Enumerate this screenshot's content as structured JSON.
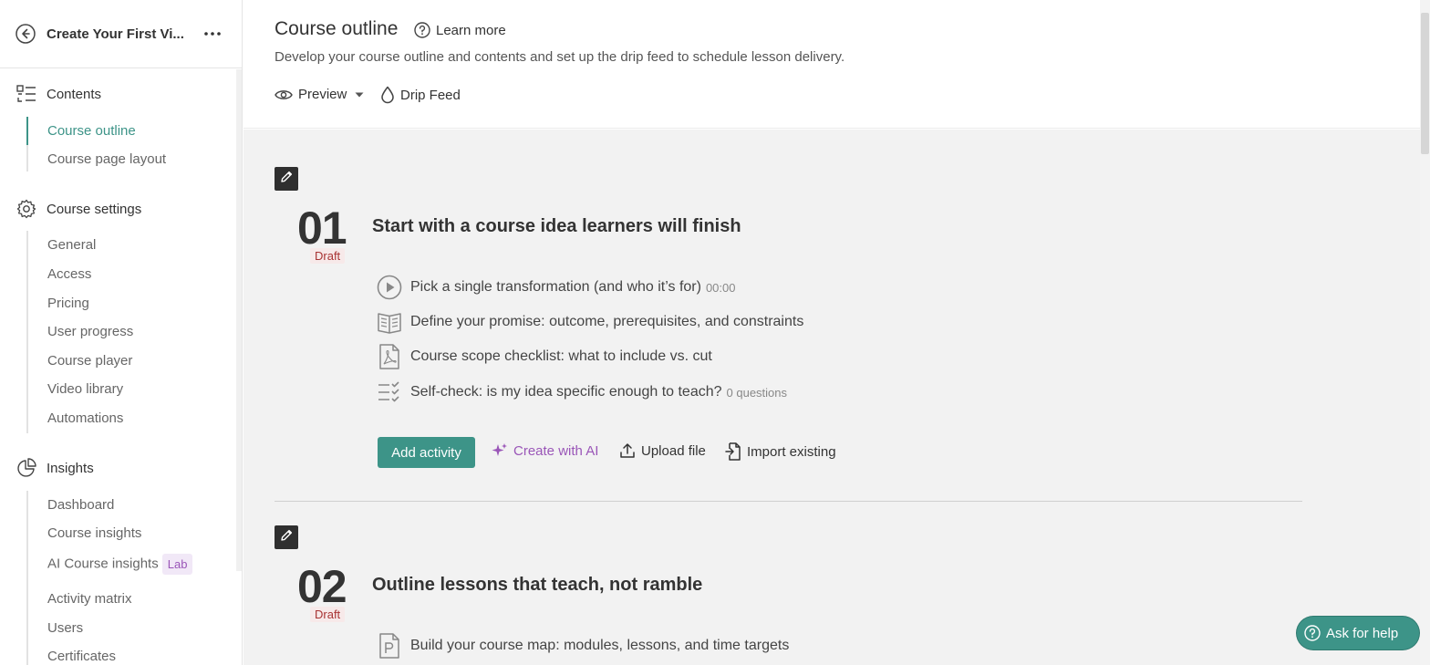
{
  "sidebar": {
    "course_title": "Create Your First Vi...",
    "sections": {
      "contents": "Contents",
      "settings": "Course settings",
      "insights": "Insights"
    },
    "contents_items": [
      "Course outline",
      "Course page layout"
    ],
    "settings_items": [
      "General",
      "Access",
      "Pricing",
      "User progress",
      "Course player",
      "Video library",
      "Automations"
    ],
    "insights_items": [
      "Dashboard",
      "Course insights",
      "AI Course insights",
      "Activity matrix",
      "Users",
      "Certificates"
    ],
    "lab_badge": "Lab"
  },
  "header": {
    "title": "Course outline",
    "learn_more": "Learn more",
    "subtitle": "Develop your course outline and contents and set up the drip feed to schedule lesson delivery.",
    "preview": "Preview",
    "drip_feed": "Drip Feed"
  },
  "chapters": [
    {
      "number": "01",
      "status": "Draft",
      "title": "Start with a course idea learners will finish",
      "activities": [
        {
          "icon": "video-play-icon",
          "label": "Pick a single transformation (and who it’s for)",
          "meta": "00:00"
        },
        {
          "icon": "open-book-icon",
          "label": "Define your promise: outcome, prerequisites, and constraints",
          "meta": ""
        },
        {
          "icon": "pdf-file-icon",
          "label": "Course scope checklist: what to include vs. cut",
          "meta": ""
        },
        {
          "icon": "quiz-checklist-icon",
          "label": "Self-check: is my idea specific enough to teach?",
          "meta": "0 questions"
        }
      ]
    },
    {
      "number": "02",
      "status": "Draft",
      "title": "Outline lessons that teach, not ramble",
      "activities": [
        {
          "icon": "presentation-file-icon",
          "label": "Build your course map: modules, lessons, and time targets",
          "meta": ""
        }
      ]
    }
  ],
  "actions": {
    "add_activity": "Add activity",
    "create_ai": "Create with AI",
    "upload_file": "Upload file",
    "import_existing": "Import existing"
  },
  "help": {
    "label": "Ask for help"
  },
  "colors": {
    "accent": "#3d9488",
    "ai_purple": "#9a56b8",
    "draft_red": "#a83232"
  }
}
